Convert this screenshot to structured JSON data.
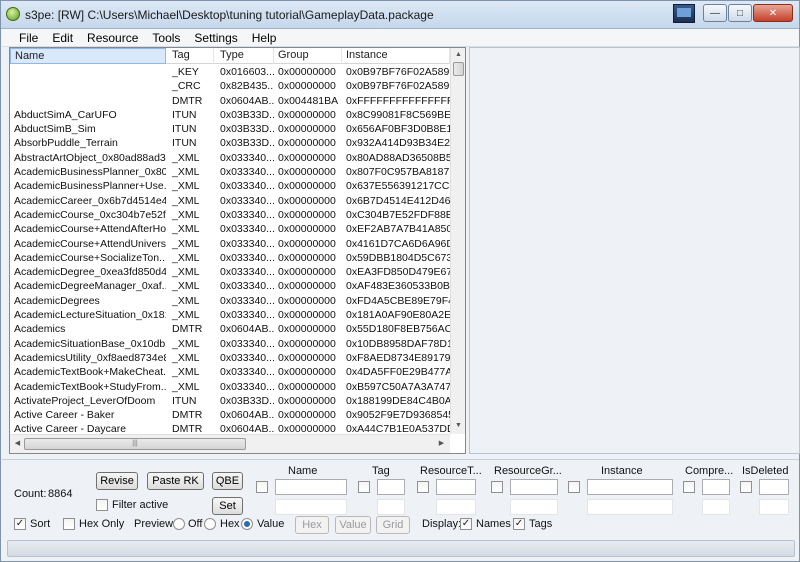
{
  "window": {
    "title": "s3pe: [RW] C:\\Users\\Michael\\Desktop\\tuning tutorial\\GameplayData.package"
  },
  "menu": [
    "File",
    "Edit",
    "Resource",
    "Tools",
    "Settings",
    "Help"
  ],
  "list": {
    "headers": {
      "name": "Name",
      "tag": "Tag",
      "type": "Type",
      "group": "Group",
      "instance": "Instance"
    },
    "rows": [
      [
        "",
        "_KEY",
        "0x016603...",
        "0x00000000",
        "0x0B97BF76F02A5899"
      ],
      [
        "",
        "_CRC",
        "0x82B435...",
        "0x00000000",
        "0x0B97BF76F02A5899"
      ],
      [
        "",
        "DMTR",
        "0x0604AB...",
        "0x004481BA",
        "0xFFFFFFFFFFFFFFFF"
      ],
      [
        "AbductSimA_CarUFO",
        "ITUN",
        "0x03B33D...",
        "0x00000000",
        "0x8C99081F8C569BEB"
      ],
      [
        "AbductSimB_Sim",
        "ITUN",
        "0x03B33D...",
        "0x00000000",
        "0x656AF0BF3D0B8E19"
      ],
      [
        "AbsorbPuddle_Terrain",
        "ITUN",
        "0x03B33D...",
        "0x00000000",
        "0x932A414D93B34E20"
      ],
      [
        "AbstractArtObject_0x80ad88ad3...",
        "_XML",
        "0x033340...",
        "0x00000000",
        "0x80AD88AD36508B55"
      ],
      [
        "AcademicBusinessPlanner_0x80...",
        "_XML",
        "0x033340...",
        "0x00000000",
        "0x807F0C957BA8187B"
      ],
      [
        "AcademicBusinessPlanner+Use...",
        "_XML",
        "0x033340...",
        "0x00000000",
        "0x637E556391217CCF"
      ],
      [
        "AcademicCareer_0x6b7d4514e4...",
        "_XML",
        "0x033340...",
        "0x00000000",
        "0x6B7D4514E412D461"
      ],
      [
        "AcademicCourse_0xc304b7e52f...",
        "_XML",
        "0x033340...",
        "0x00000000",
        "0xC304B7E52FDF88E0"
      ],
      [
        "AcademicCourse+AttendAfterHo...",
        "_XML",
        "0x033340...",
        "0x00000000",
        "0xEF2AB7A7B41A850C"
      ],
      [
        "AcademicCourse+AttendUnivers...",
        "_XML",
        "0x033340...",
        "0x00000000",
        "0x4161D7CA6D6A96D6"
      ],
      [
        "AcademicCourse+SocializeTon...",
        "_XML",
        "0x033340...",
        "0x00000000",
        "0x59DBB1804D5C6738"
      ],
      [
        "AcademicDegree_0xea3fd850d4...",
        "_XML",
        "0x033340...",
        "0x00000000",
        "0xEA3FD850D479E67B"
      ],
      [
        "AcademicDegreeManager_0xaf...",
        "_XML",
        "0x033340...",
        "0x00000000",
        "0xAF483E360533B0B0"
      ],
      [
        "AcademicDegrees",
        "_XML",
        "0x033340...",
        "0x00000000",
        "0xFD4A5CBE89E79F47"
      ],
      [
        "AcademicLectureSituation_0x181...",
        "_XML",
        "0x033340...",
        "0x00000000",
        "0x181A0AF90E80A2E8"
      ],
      [
        "Academics",
        "DMTR",
        "0x0604AB...",
        "0x00000000",
        "0x55D180F8EB756ACF"
      ],
      [
        "AcademicSituationBase_0x10db...",
        "_XML",
        "0x033340...",
        "0x00000000",
        "0x10DB8958DAF78D1D"
      ],
      [
        "AcademicsUtility_0xf8aed8734e8...",
        "_XML",
        "0x033340...",
        "0x00000000",
        "0xF8AED8734E89179A"
      ],
      [
        "AcademicTextBook+MakeCheat...",
        "_XML",
        "0x033340...",
        "0x00000000",
        "0x4DA5FF0E29B477AC"
      ],
      [
        "AcademicTextBook+StudyFrom...",
        "_XML",
        "0x033340...",
        "0x00000000",
        "0xB597C50A7A3A7470"
      ],
      [
        "ActivateProject_LeverOfDoom",
        "ITUN",
        "0x03B33D...",
        "0x00000000",
        "0x188199DE84C4B0A8"
      ],
      [
        "Active Career - Baker",
        "DMTR",
        "0x0604AB...",
        "0x00000000",
        "0x9052F9E7D9368545"
      ],
      [
        "Active Career - Daycare",
        "DMTR",
        "0x0604AB...",
        "0x00000000",
        "0xA44C7B1E0A537DDB"
      ]
    ]
  },
  "bottom": {
    "count_label": "Count:",
    "count_value": "8864",
    "revise": "Revise",
    "paste_rk": "Paste RK",
    "qbe": "QBE",
    "set": "Set",
    "filter_active": "Filter active",
    "filter_headers": [
      "Name",
      "Tag",
      "ResourceT...",
      "ResourceGr...",
      "Instance",
      "Compre...",
      "IsDeleted"
    ],
    "sort": "Sort",
    "hex_only": "Hex Only",
    "preview_label": "Preview:",
    "preview_off": "Off",
    "preview_hex": "Hex",
    "preview_value": "Value",
    "hex_btn": "Hex",
    "value_btn": "Value",
    "grid_btn": "Grid",
    "display_label": "Display:",
    "display_names": "Names",
    "display_tags": "Tags"
  },
  "colors": {
    "selected_header": "#d7e9fb",
    "radio_on": "#2a6ab5",
    "close": "#c4402a"
  }
}
